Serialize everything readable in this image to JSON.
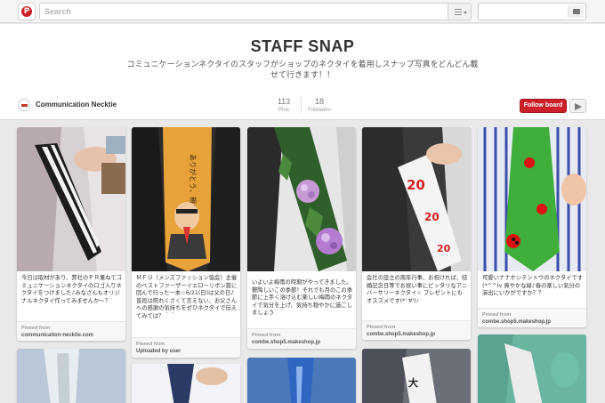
{
  "colors": {
    "brand_red": "#cb2027",
    "background": "#e9e9e9"
  },
  "topbar": {
    "logo_icon": "pinterest-logo-icon",
    "logo_text": "P",
    "search_placeholder": "Search",
    "menu_icon": "menu-icon",
    "messages_icon": "messages-icon"
  },
  "board": {
    "title": "STAFF SNAP",
    "description": "コミュニケーションネクタイのスタッフがショップのネクタイを着用しスナップ写真をどんどん載せて行きます！！",
    "owner_name": "Communication Necktie",
    "pins_count": "113",
    "pins_label": "Pins",
    "followers_count": "18",
    "followers_label": "Followers",
    "follow_label": "Follow board",
    "send_icon": "send-icon"
  },
  "pins": [
    {
      "description": "今日は取材があり、弊社のＰＲ兼ねてコミュニケーションネクタイのロゴ入りネクタイをつけました♪みなさんもオリジナルネクタイ作ってみませんか～？",
      "pinned_from_label": "Pinned from",
      "source": "communication-necktie.com"
    },
    {
      "description": "ＭＦＵ（メンズファッション協会）主催のベストファーザーイエローリボン賞に因んで行った一本☆6/21(日)は父の日♪普段は照れくさくて言えない、お父さんへの感謝の気持ちをぜひネクタイで伝えてみては？＾＾",
      "pinned_from_label": "Pinned from",
      "source": "Uploaded by user"
    },
    {
      "description": "いよいよ梅雨の時期がやってきました。鬱陶しいこの季節！それでも月のこの季節に上手く溶け込む楽しい梅雨のネクタイで気分を上げ、気持ち穏やかに過ごしましょう＾＾",
      "pinned_from_label": "Pinned from",
      "source": "combe.shop5.makeshop.jp"
    },
    {
      "description": "会社の設立の周年行事、お祝ければ、結婚記念日等でお祝い事にピッタリなアニバーサリーネクタイ☆ プレゼントにもオススメです(*' ∀')ﾉ",
      "pinned_from_label": "Pinned from",
      "source": "combe.shop5.makeshop.jp"
    },
    {
      "description": "可愛いナナホシテントウのネクタイです(*^^)v 爽やかな緑♪春の楽しい気分の演出にいかがですか？？",
      "pinned_from_label": "Pinned from",
      "source": "combe.shop5.makeshop.jp"
    }
  ]
}
